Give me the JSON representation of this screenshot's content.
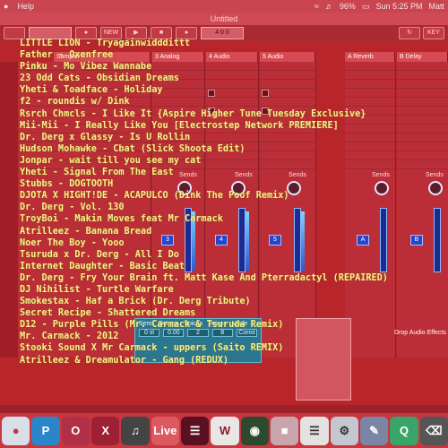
{
  "menubar": {
    "help": "Help",
    "battery": "96%",
    "clock": "Sun 5:25 PM",
    "user": "Matt"
  },
  "window": {
    "title": "Untitled"
  },
  "toolbar": {
    "new_label": "NEW",
    "position": "4  0  0",
    "key_label": "KEY"
  },
  "track_headers": [
    "Sampler",
    "3 Analog",
    "4 Audio",
    "5 Audio",
    "A Reverb",
    "B Delay"
  ],
  "mixer": {
    "sends_label": "Sends",
    "track_numbers": [
      "3",
      "4",
      "5",
      "A",
      "B"
    ]
  },
  "device": {
    "params": [
      "Semi",
      "Detune",
      "Voices",
      "Voices",
      "Mode"
    ],
    "values": [
      "0 st",
      "0.00",
      "2",
      "8",
      "Const"
    ]
  },
  "drop_hint": "Drop Audio Effects",
  "tracklist": [
    "LITTLE LION - Tryagainwidddittt",
    "Father - Oxenfree",
    "Pinku - Mo Vibez Wannabe",
    "23 Odd Cats - Obsidian Dreams",
    "Yheti & Toadface - Holiday",
    "f2 - roundis w/ Dink",
    "Rsrch Chmcls - I Like It {Aspire Higher Tune Tuesday Exclusive}",
    "Mii-Mii - I Really Like You [Electrostep Network PREMIERE]",
    "Dr. Derg x Glassy - Is U Rollin",
    "Hudson Mohawke - Cbat (Slick Shoota Edit)",
    "Jonpar - wait till you see my cat",
    "Yheti - Signal From The East",
    "Stubbs - DOGTOOTH",
    "DJOTA X HIGHT!DE - ACAPULCO (Dink The Poof Remix)",
    "Dr. Derg - Vol. 130",
    "TroyBoi - Makin Moves feat Mr Carmack",
    "Atrilleez - Banana Bread",
    "Noer The Boy - Yooo",
    "Tsuruda x Dr. Derg - All I Do",
    "Internet Daughter - Basic Beat",
    "Dr. Derg - Fry Your Brain ft. Matt Kase And Pterradactyl (REPAIRED)",
    "DJ Nihilist - Turtle Warfare",
    "Smokestax - Haf a Brick (Dr. Derg Tribute)",
    "Secret Recipe - Shattered Dreams",
    "D12 - Purple Pills (Mr. Carmack & Tsuruda Remix)",
    "Mr. Carmack - 2012",
    "Stooki Sound X Mr Carmack - uppers (Saito REMIX)",
    "Atrilleez & Dreamulator - Gang (REDUX)"
  ],
  "dock": {
    "icons": [
      "P",
      "O",
      "X",
      "Live",
      "W",
      "Q"
    ]
  }
}
